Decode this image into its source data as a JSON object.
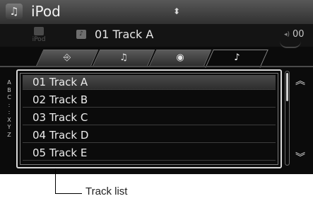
{
  "header": {
    "title": "iPod"
  },
  "now_playing": {
    "source_logo": "iPod",
    "track_title": "01 Track A",
    "volume": "00"
  },
  "tabs": [
    {
      "icon": "usb-icon",
      "glyph": "⎆"
    },
    {
      "icon": "artists-icon",
      "glyph": "♪"
    },
    {
      "icon": "album-icon",
      "glyph": "◉"
    },
    {
      "icon": "songs-icon",
      "glyph": "♪",
      "active": true
    }
  ],
  "alpha_index": [
    "A",
    "B",
    "C",
    ":",
    ":",
    "X",
    "Y",
    "Z"
  ],
  "track_list": [
    "01 Track A",
    "02 Track B",
    "03 Track C",
    "04 Track D",
    "05 Track E"
  ],
  "selected_index": 0,
  "callout": {
    "label": "Track list"
  }
}
